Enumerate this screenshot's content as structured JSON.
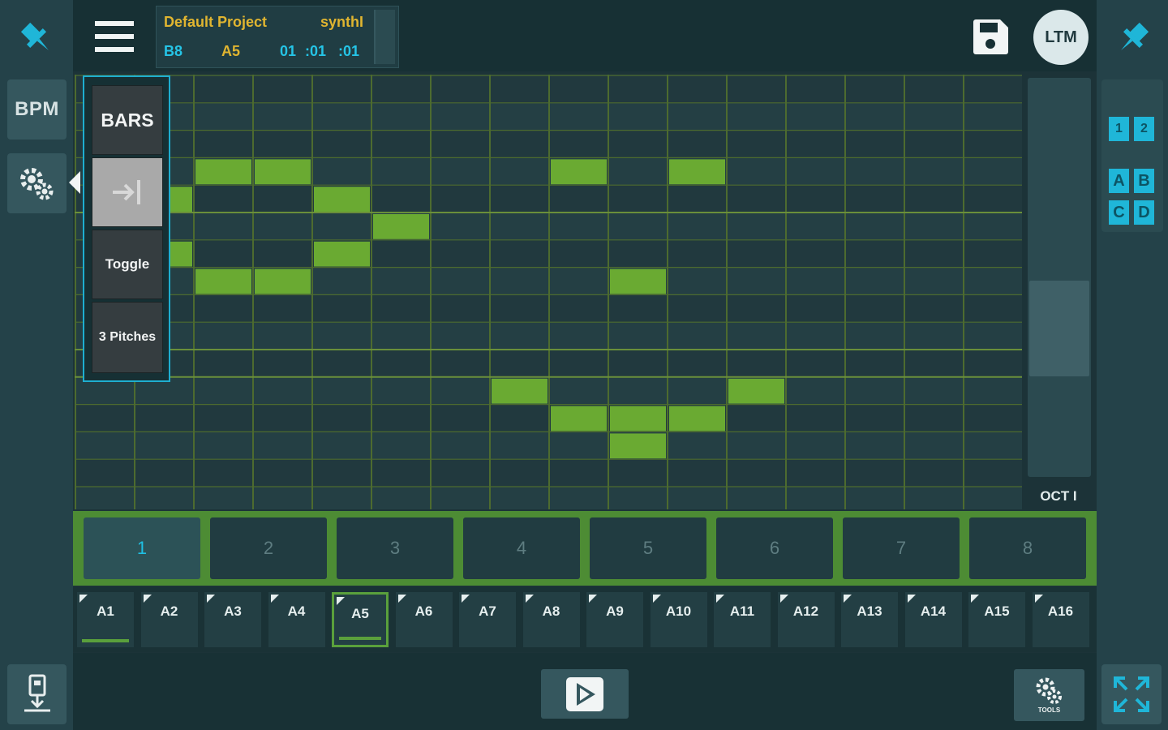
{
  "colors": {
    "accent": "#1fb6d8",
    "note_green": "#6aaa32",
    "grid_line": "#4d6b2f",
    "background": "#1c3338"
  },
  "left_rail": {
    "pin_icon": "pin-icon",
    "bpm_label": "BPM",
    "settings_icon": "gears-icon",
    "export_icon": "download-icon"
  },
  "header": {
    "menu_icon": "hamburger-menu-icon",
    "project_name": "Default Project",
    "instrument": "synthI",
    "bank": "B8",
    "pattern": "A5",
    "position_bar": "01",
    "position_beat": ":01",
    "position_tick": ":01",
    "save_icon": "save-icon",
    "ltm_label": "LTM"
  },
  "right_rail": {
    "pin_icon": "pin-icon",
    "page_buttons": [
      "1",
      "2"
    ],
    "variation_buttons": [
      "A",
      "B",
      "C",
      "D"
    ],
    "fullscreen_icon": "expand-icon"
  },
  "popup": {
    "bars_label": "BARS",
    "jump_icon": "arrow-to-line-icon",
    "toggle_label": "Toggle",
    "pitches_label": "3 Pitches"
  },
  "piano_roll": {
    "columns": 16,
    "rows": 15,
    "octave_label": "OCT I",
    "notes": [
      {
        "col": 2,
        "row": 3
      },
      {
        "col": 3,
        "row": 3
      },
      {
        "col": 4,
        "row": 4
      },
      {
        "col": 5,
        "row": 5
      },
      {
        "col": 4,
        "row": 6
      },
      {
        "col": 2,
        "row": 7
      },
      {
        "col": 3,
        "row": 7
      },
      {
        "col": 8,
        "row": 3
      },
      {
        "col": 10,
        "row": 3
      },
      {
        "col": 9,
        "row": 7
      },
      {
        "col": 7,
        "row": 11
      },
      {
        "col": 11,
        "row": 11
      },
      {
        "col": 8,
        "row": 12
      },
      {
        "col": 9,
        "row": 12
      },
      {
        "col": 10,
        "row": 12
      },
      {
        "col": 9,
        "row": 13
      },
      {
        "col": 1,
        "row": 4
      },
      {
        "col": 1,
        "row": 6
      }
    ]
  },
  "bars": {
    "labels": [
      "1",
      "2",
      "3",
      "4",
      "5",
      "6",
      "7",
      "8"
    ],
    "active": 0
  },
  "patterns": {
    "labels": [
      "A1",
      "A2",
      "A3",
      "A4",
      "A5",
      "A6",
      "A7",
      "A8",
      "A9",
      "A10",
      "A11",
      "A12",
      "A13",
      "A14",
      "A15",
      "A16"
    ],
    "selected": 4,
    "playing": 0
  },
  "transport": {
    "play_icon": "play-icon",
    "tools_icon": "tools-icon",
    "tools_label": "TOOLS"
  }
}
